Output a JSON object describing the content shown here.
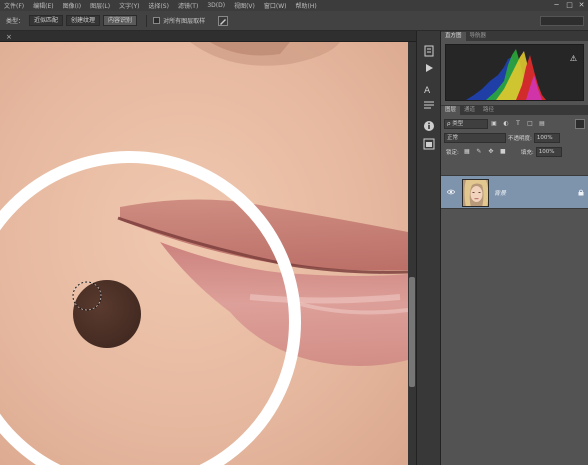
{
  "menu": {
    "items": [
      "滤镜(T)",
      "3D(D)",
      "视图(V)",
      "窗口(W)",
      "帮助(H)"
    ],
    "window_controls": [
      "─",
      "□",
      "✕"
    ]
  },
  "options_bar": {
    "type_label": "类型：",
    "buttons": [
      "近似匹配",
      "创建纹理",
      "内容识别"
    ],
    "sample_all_label": "对所有图层取样",
    "selected_button_index": 2
  },
  "document": {
    "tab_close": "×"
  },
  "histogram_panel": {
    "tabs": [
      "直方图",
      "导航器"
    ],
    "warning_icon": "⚠"
  },
  "layers_panel": {
    "tabs": [
      "图层",
      "通道",
      "路径"
    ],
    "filter_label": "ρ 类型",
    "blend_mode": "正常",
    "opacity_label": "不透明度:",
    "opacity_value": "100%",
    "lock_label": "锁定:",
    "fill_label": "填充:",
    "fill_value": "100%",
    "layers": [
      {
        "name": "背景",
        "visible": true,
        "locked": true,
        "selected": true
      }
    ]
  },
  "colors": {
    "accent_selected_layer": "#7e93ac",
    "panel_bg": "#535353",
    "skin": "#e8bea4",
    "spot": "#4a3026"
  }
}
